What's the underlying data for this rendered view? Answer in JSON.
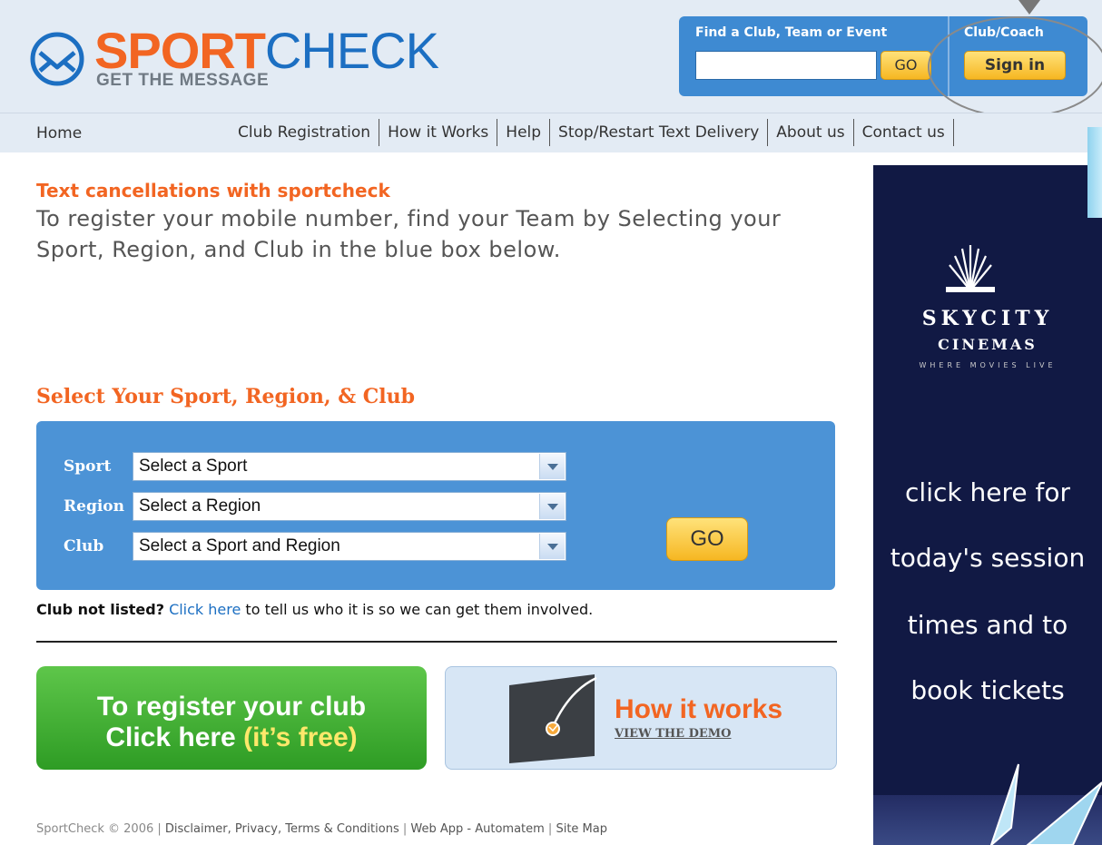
{
  "header": {
    "logo_sport": "SPORT",
    "logo_check": "CHECK",
    "logo_tagline": "GET THE MESSAGE",
    "find_label": "Find a Club, Team or Event",
    "find_input_value": "",
    "find_go_label": "GO",
    "coach_label": "Club/Coach",
    "signin_label": "Sign in"
  },
  "nav": {
    "home": "Home",
    "links": [
      "Club Registration",
      "How it Works",
      "Help",
      "Stop/Restart Text Delivery",
      "About us",
      "Contact us"
    ]
  },
  "intro": {
    "title": "Text cancellations with sportcheck",
    "text": "To register your mobile number, find your Team by Selecting your Sport, Region, and Club in the blue box below."
  },
  "selector": {
    "title": "Select Your Sport, Region, & Club",
    "sport_label": "Sport",
    "sport_value": "Select a Sport",
    "region_label": "Region",
    "region_value": "Select a Region",
    "club_label": "Club",
    "club_value": "Select a Sport and Region",
    "go_label": "GO"
  },
  "club_note": {
    "strong": "Club not listed?",
    "link": "Click here",
    "rest": " to tell us who it is so we can get them involved."
  },
  "register": {
    "line1": "To register your club",
    "line2": "Click here ",
    "free": "(it’s free)"
  },
  "demo": {
    "title": "How it works",
    "link": "VIEW THE DEMO"
  },
  "footer": {
    "copyright": "SportCheck © 2006 | ",
    "links": [
      "Disclaimer, Privacy, Terms & Conditions",
      "Web App - Automatem",
      "Site Map"
    ]
  },
  "ad": {
    "brand_line1": "SKYCITY",
    "brand_line2": "CINEMAS",
    "brand_tagline": "WHERE MOVIES LIVE",
    "lines": [
      "click here for",
      "today's session",
      "times and to",
      "book tickets"
    ]
  },
  "colors": {
    "brand_orange": "#f26522",
    "brand_blue": "#1c6fc2",
    "selector_blue": "#4c93d6",
    "button_yellow": "#f6b722",
    "register_green": "#2e9c24",
    "ad_navy": "#111944"
  },
  "icons": {
    "logo": "envelope-in-circle-icon",
    "dropdown": "chevron-down-icon",
    "demo": "monitor-icon"
  }
}
